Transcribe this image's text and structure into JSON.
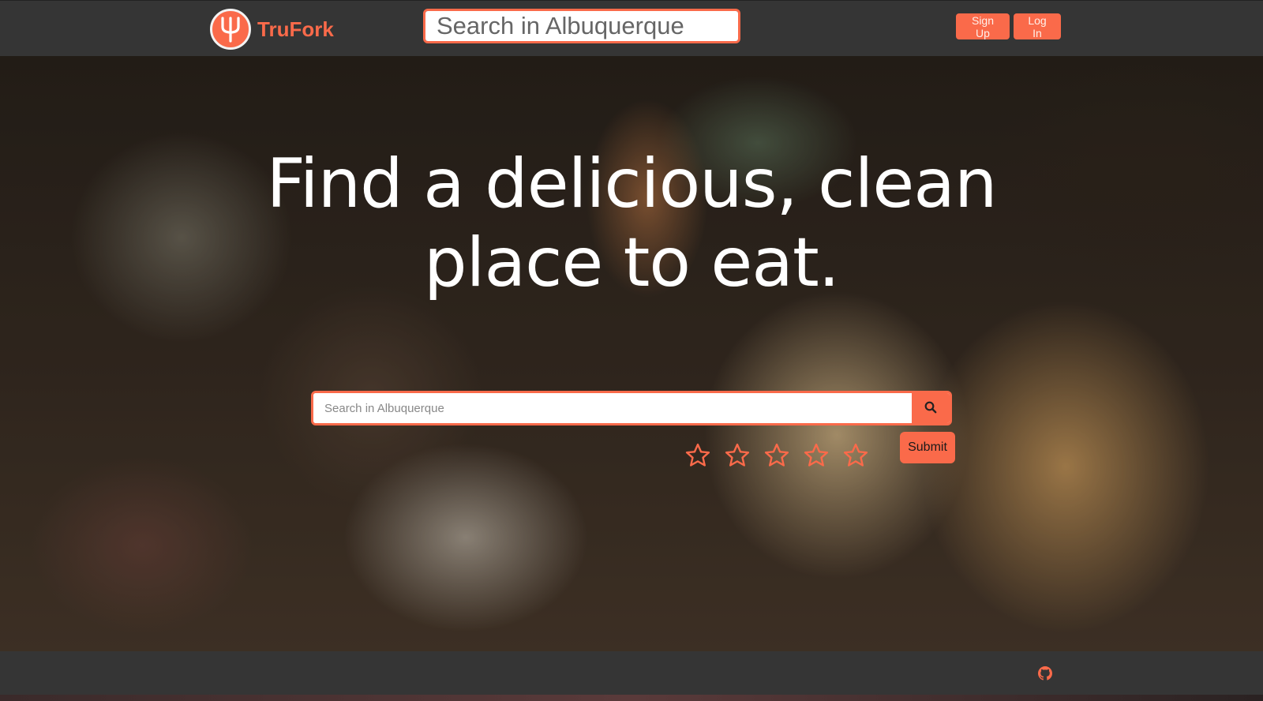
{
  "navbar": {
    "brand_name": "TruFork",
    "logo_icon": "fork-logo-icon",
    "search_placeholder": "Search in Albuquerque",
    "search_icon": "search-icon",
    "signup_label": "Sign Up",
    "login_label": "Log In"
  },
  "hero": {
    "headline_line1": "Find a delicious, clean",
    "headline_line2": "place to eat.",
    "search_placeholder": "Search in Albuquerque",
    "search_icon": "search-icon",
    "rating": {
      "max": 5,
      "selected": 0,
      "icon": "star-outline-icon"
    },
    "submit_label": "Submit"
  },
  "footer": {
    "github_icon": "github-icon"
  },
  "colors": {
    "accent": "#fa6a4a",
    "navbar_bg": "#353535",
    "headline_text": "#ffffff"
  }
}
